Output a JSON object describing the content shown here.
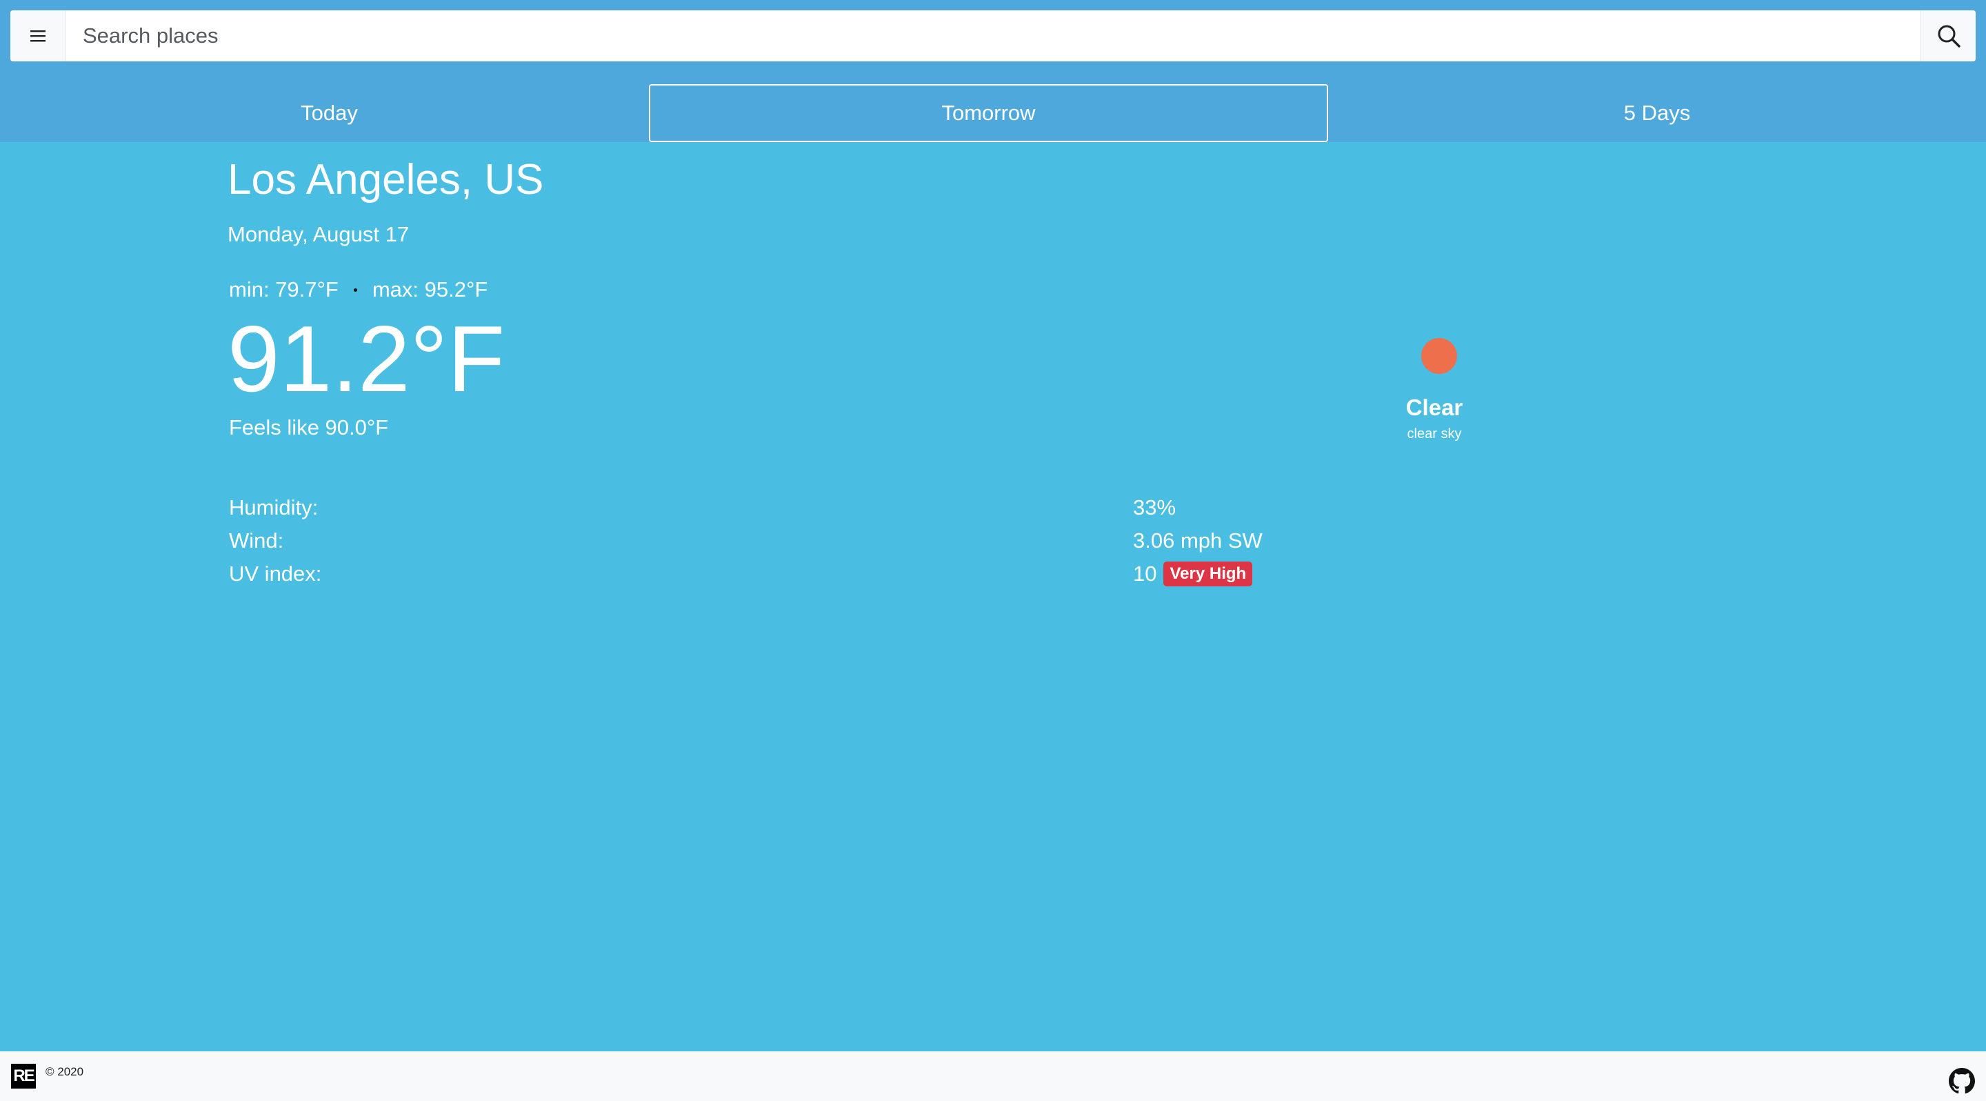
{
  "search": {
    "placeholder": "Search places",
    "menu_icon": "hamburger-menu-icon",
    "search_icon": "magnifier-search-icon"
  },
  "tabs": [
    {
      "label": "Today",
      "active": false
    },
    {
      "label": "Tomorrow",
      "active": true
    },
    {
      "label": "5 Days",
      "active": false
    }
  ],
  "weather": {
    "city": "Los Angeles, US",
    "date": "Monday, August 17",
    "min": "min: 79.7°F",
    "max": "max: 95.2°F",
    "temperature": "91.2°F",
    "feels_like": "Feels like 90.0°F",
    "condition": "Clear",
    "description": "clear sky",
    "condition_icon": "sun-icon",
    "sun_color": "#ee6f4c"
  },
  "details": [
    {
      "label": "Humidity:",
      "value": "33%"
    },
    {
      "label": "Wind:",
      "value": "3.06 mph SW"
    },
    {
      "label": "UV index:",
      "value": "10",
      "badge": "Very High",
      "badge_color": "#dc3545"
    }
  ],
  "footer": {
    "logo_text": "RE",
    "copyright": "© 2020",
    "github_icon": "github-icon"
  },
  "colors": {
    "header_bg": "#4fa8dc",
    "main_bg": "#4abee2",
    "footer_bg": "#f8f9fa"
  }
}
